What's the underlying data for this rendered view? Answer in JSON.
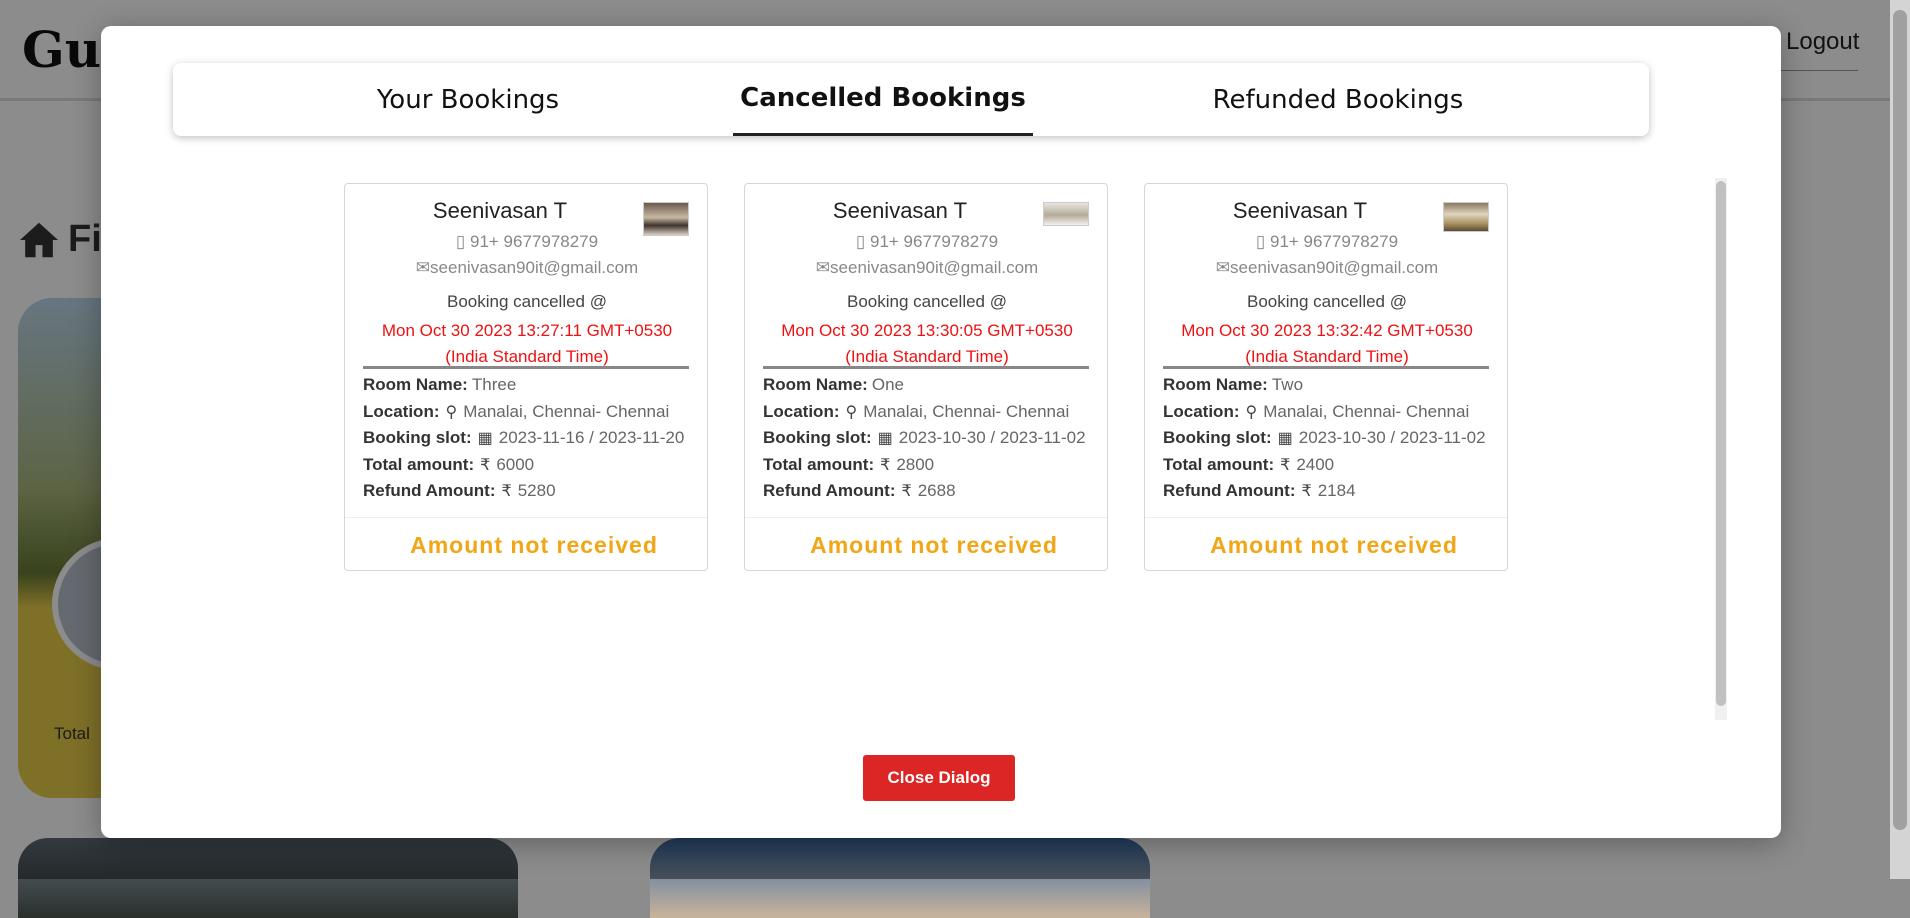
{
  "background": {
    "brand": "Gus",
    "logout_label": "Logout",
    "find_label": "Fi",
    "card_total_label": "Total "
  },
  "tabs": [
    {
      "label": "Your Bookings",
      "active": false
    },
    {
      "label": "Cancelled Bookings",
      "active": true
    },
    {
      "label": "Refunded Bookings",
      "active": false
    }
  ],
  "labels": {
    "cancelled_at": "Booking cancelled @",
    "room_name": "Room Name:",
    "location": "Location:",
    "booking_slot": "Booking slot:",
    "total_amount": "Total amount:",
    "refund_amount": "Refund Amount:"
  },
  "icons": {
    "phone": "phone-icon",
    "email": "envelope-icon",
    "location": "map-marker-icon",
    "calendar": "calendar-icon",
    "currency": "rupee-icon"
  },
  "colors": {
    "cancel_time": "#e11111",
    "status": "#f2a515",
    "close_button": "#dc2525"
  },
  "bookings": [
    {
      "name": "Seenivasan T",
      "phone": "91+ 9677978279",
      "email": "seenivasan90it@gmail.com",
      "cancelled_time": "Mon Oct 30 2023 13:27:11 GMT+0530",
      "cancelled_tz": "(India Standard Time)",
      "room_name": "Three",
      "location": "Manalai, Chennai- Chennai",
      "booking_slot": "2023-11-16 / 2023-11-20",
      "total_amount": "6000",
      "refund_amount": "5280",
      "status": "Amount not received"
    },
    {
      "name": "Seenivasan T",
      "phone": "91+ 9677978279",
      "email": "seenivasan90it@gmail.com",
      "cancelled_time": "Mon Oct 30 2023 13:30:05 GMT+0530",
      "cancelled_tz": "(India Standard Time)",
      "room_name": "One",
      "location": "Manalai, Chennai- Chennai",
      "booking_slot": "2023-10-30 / 2023-11-02",
      "total_amount": "2800",
      "refund_amount": "2688",
      "status": "Amount not received"
    },
    {
      "name": "Seenivasan T",
      "phone": "91+ 9677978279",
      "email": "seenivasan90it@gmail.com",
      "cancelled_time": "Mon Oct 30 2023 13:32:42 GMT+0530",
      "cancelled_tz": "(India Standard Time)",
      "room_name": "Two",
      "location": "Manalai, Chennai- Chennai",
      "booking_slot": "2023-10-30 / 2023-11-02",
      "total_amount": "2400",
      "refund_amount": "2184",
      "status": "Amount not received"
    }
  ],
  "close_button_label": "Close Dialog"
}
